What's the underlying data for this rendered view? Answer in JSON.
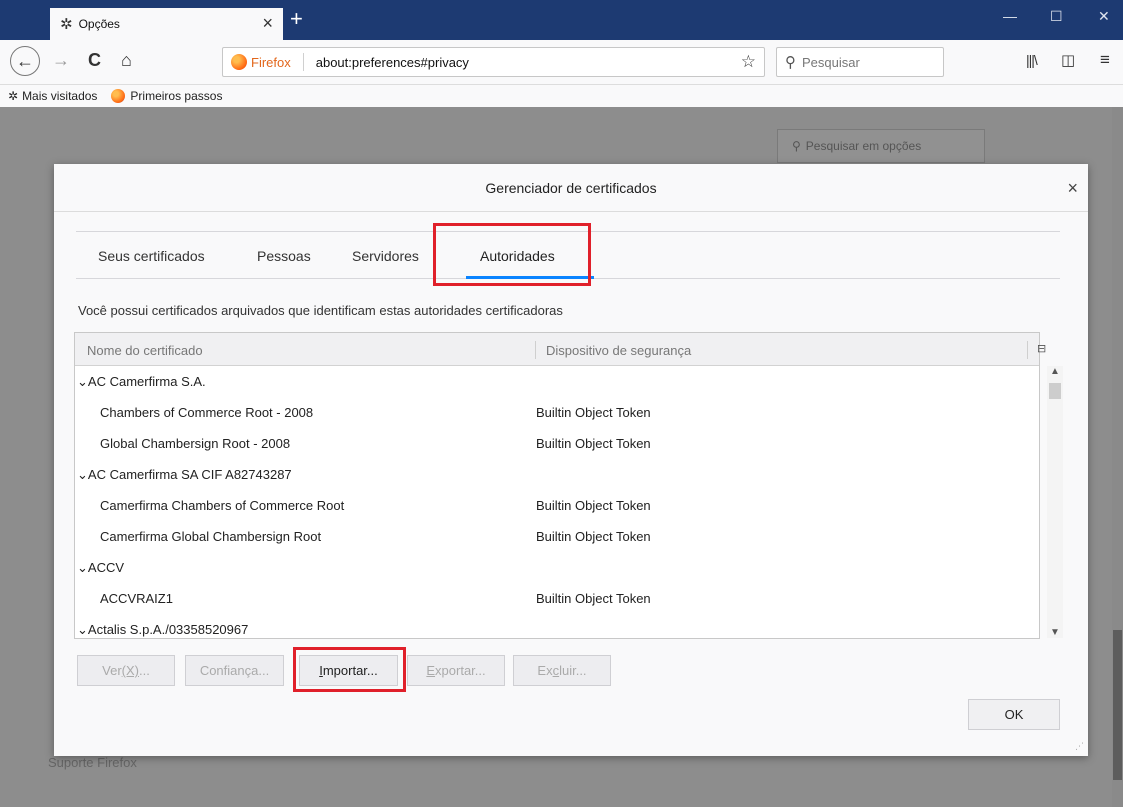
{
  "browser": {
    "tab_title": "Opções",
    "tab_close": "×",
    "new_tab": "+",
    "window_controls": {
      "minimize": "—",
      "maximize": "☐",
      "close": "✕"
    },
    "nav": {
      "back": "←",
      "forward": "→",
      "reload": "C",
      "home": "⌂"
    },
    "identity_label": "Firefox",
    "url": "about:preferences#privacy",
    "search_placeholder": "Pesquisar",
    "toolbar_icons": [
      "library-icon",
      "sidebar-icon",
      "menu-icon"
    ],
    "bookmarks": [
      {
        "label": "Mais visitados",
        "icon": "gear-icon"
      },
      {
        "label": "Primeiros passos",
        "icon": "firefox-icon"
      }
    ]
  },
  "background_page": {
    "search_placeholder": "Pesquisar em opções",
    "footer_text": "Suporte Firefox"
  },
  "dialog": {
    "title": "Gerenciador de certificados",
    "close": "×",
    "tabs": [
      {
        "label": "Seus certificados",
        "active": false
      },
      {
        "label": "Pessoas",
        "active": false
      },
      {
        "label": "Servidores",
        "active": false
      },
      {
        "label": "Autoridades",
        "active": true
      }
    ],
    "description": "Você possui certificados arquivados que identificam estas autoridades certificadoras",
    "columns": {
      "name": "Nome do certificado",
      "device": "Dispositivo de segurança"
    },
    "rows": [
      {
        "type": "group",
        "name": "AC Camerfirma S.A.",
        "device": ""
      },
      {
        "type": "item",
        "name": "Chambers of Commerce Root - 2008",
        "device": "Builtin Object Token"
      },
      {
        "type": "item",
        "name": "Global Chambersign Root - 2008",
        "device": "Builtin Object Token"
      },
      {
        "type": "group",
        "name": "AC Camerfirma SA CIF A82743287",
        "device": ""
      },
      {
        "type": "item",
        "name": "Camerfirma Chambers of Commerce Root",
        "device": "Builtin Object Token"
      },
      {
        "type": "item",
        "name": "Camerfirma Global Chambersign Root",
        "device": "Builtin Object Token"
      },
      {
        "type": "group",
        "name": "ACCV",
        "device": ""
      },
      {
        "type": "item",
        "name": "ACCVRAIZ1",
        "device": "Builtin Object Token"
      },
      {
        "type": "group",
        "name": "Actalis S.p.A./03358520967",
        "device": ""
      }
    ],
    "buttons": {
      "view": {
        "before": "Ver ",
        "key": "(X)",
        "after": "...",
        "enabled": false
      },
      "trust": {
        "before": "Confiança...",
        "key": "",
        "after": "",
        "enabled": false
      },
      "import": {
        "before": "",
        "key": "I",
        "after": "mportar...",
        "enabled": true
      },
      "export": {
        "before": "",
        "key": "E",
        "after": "xportar...",
        "enabled": false
      },
      "delete": {
        "before": "Ex",
        "key": "c",
        "after": "luir...",
        "enabled": false
      },
      "ok": "OK"
    }
  },
  "colors": {
    "highlight": "#e0202a",
    "tab_accent": "#0a84ff",
    "titlebar": "#1d3a72"
  }
}
